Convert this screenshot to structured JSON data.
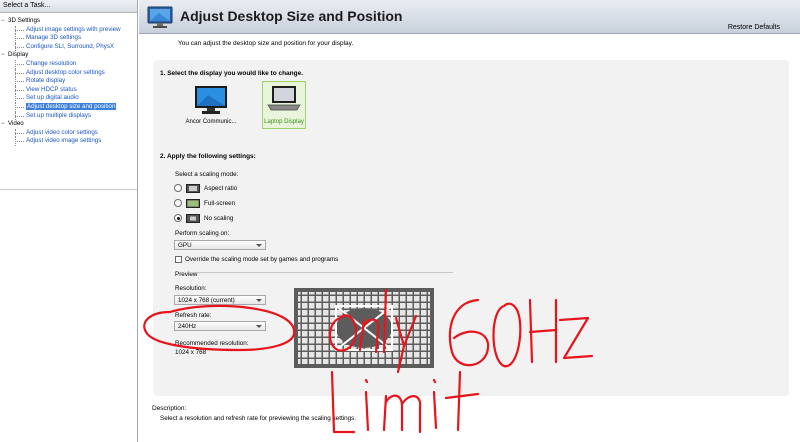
{
  "left_pane": {
    "header": "Select a Task...",
    "tree": [
      {
        "type": "cat",
        "label": "3D Settings"
      },
      {
        "type": "sub",
        "label": "Adjust image settings with preview"
      },
      {
        "type": "sub",
        "label": "Manage 3D settings"
      },
      {
        "type": "sub",
        "label": "Configure SLI, Surround, PhysX"
      },
      {
        "type": "cat",
        "label": "Display"
      },
      {
        "type": "sub",
        "label": "Change resolution"
      },
      {
        "type": "sub",
        "label": "Adjust desktop color settings"
      },
      {
        "type": "sub",
        "label": "Rotate display"
      },
      {
        "type": "sub",
        "label": "View HDCP status"
      },
      {
        "type": "sub",
        "label": "Set up digital audio"
      },
      {
        "type": "sub",
        "label": "Adjust desktop size and position",
        "selected": true
      },
      {
        "type": "sub",
        "label": "Set up multiple displays"
      },
      {
        "type": "cat",
        "label": "Video"
      },
      {
        "type": "sub",
        "label": "Adjust video color settings"
      },
      {
        "type": "sub",
        "label": "Adjust video image settings"
      }
    ]
  },
  "header": {
    "title": "Adjust Desktop Size and Position",
    "restore_defaults": "Restore Defaults"
  },
  "intro": "You can adjust the desktop size and position for your display.",
  "section1": {
    "title": "1. Select the display you would like to change.",
    "displays": [
      {
        "label": "Ancor Communic...",
        "selected": false
      },
      {
        "label": "Laptop Display",
        "selected": true
      }
    ]
  },
  "section2": {
    "title": "2. Apply the following settings:",
    "scaling_mode_label": "Select a scaling mode:",
    "modes": [
      {
        "label": "Aspect ratio",
        "selected": false
      },
      {
        "label": "Full-screen",
        "selected": false
      },
      {
        "label": "No scaling",
        "selected": true
      }
    ],
    "perform_scaling_label": "Perform scaling on:",
    "perform_scaling_value": "GPU",
    "override_label": "Override the scaling mode set by games and programs",
    "override_checked": false
  },
  "preview": {
    "label": "Preview",
    "resolution_label": "Resolution:",
    "resolution_value": "1024 x 768 (current)",
    "refresh_label": "Refresh rate:",
    "refresh_value": "240Hz",
    "recommended_label": "Recommended resolution:",
    "recommended_value": "1024 x 768"
  },
  "description": {
    "label": "Description:",
    "text": "Select a resolution and refresh rate for previewing the scaling settings."
  },
  "annotation": {
    "handwriting": "only 60Hz Limit",
    "color": "#e8141b"
  },
  "colors": {
    "link_blue": "#1a55c9",
    "selection_blue": "#3b7fd8",
    "nvidia_green": "#76b900",
    "selected_display_green": "#3f8f1a"
  }
}
